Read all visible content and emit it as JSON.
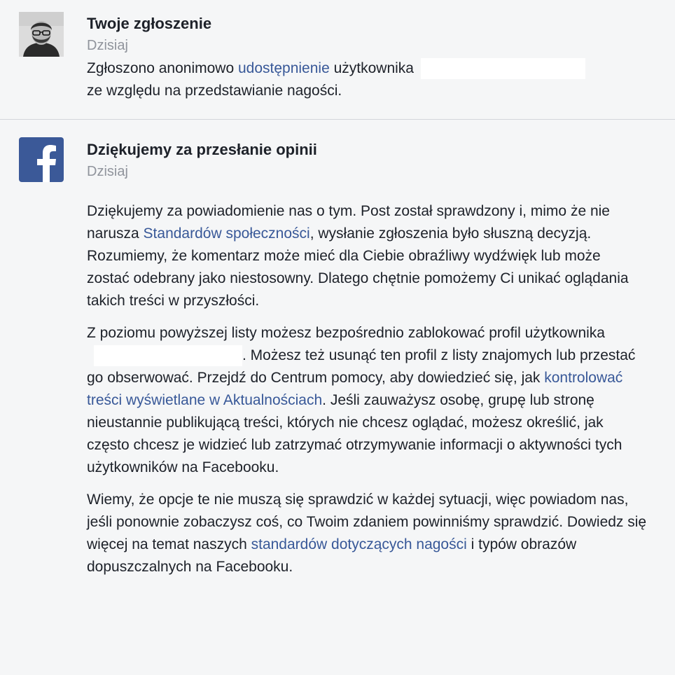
{
  "report": {
    "title": "Twoje zgłoszenie",
    "time": "Dzisiaj",
    "text_before": "Zgłoszono anonimowo ",
    "link": "udostępnienie",
    "text_after": " użytkownika",
    "line2": "ze względu na przedstawianie nagości."
  },
  "feedback": {
    "title": "Dziękujemy za przesłanie opinii",
    "time": "Dzisiaj",
    "p1_a": "Dziękujemy za powiadomienie nas o tym. Post został sprawdzony i, mimo że nie narusza ",
    "p1_link": "Standardów społeczności",
    "p1_b": ", wysłanie zgłoszenia było słuszną decyzją. Rozumiemy, że komentarz może mieć dla Ciebie obraźliwy wydźwięk lub może zostać odebrany jako niestosowny. Dlatego chętnie pomożemy Ci unikać oglądania takich treści w przyszłości.",
    "p2_a": "Z poziomu powyższej listy możesz bezpośrednio zablokować profil użytkownika",
    "p2_b": ". Możesz też usunąć ten profil z listy znajomych lub przestać go obserwować. Przejdź do Centrum pomocy, aby dowiedzieć się, jak ",
    "p2_link": "kontrolować treści wyświetlane w Aktualnościach",
    "p2_c": ". Jeśli zauważysz osobę, grupę lub stronę nieustannie publikującą treści, których nie chcesz oglądać, możesz określić, jak często chcesz je widzieć lub zatrzymać otrzymywanie informacji o aktywności tych użytkowników na Facebooku.",
    "p3_a": "Wiemy, że opcje te nie muszą się sprawdzić w każdej sytuacji, więc powiadom nas, jeśli ponownie zobaczysz coś, co Twoim zdaniem powinniśmy sprawdzić. Dowiedz się więcej na temat naszych ",
    "p3_link": "standardów dotyczących nagości",
    "p3_b": " i typów obrazów dopuszczalnych na Facebooku."
  },
  "icons": {
    "avatar": "user-avatar-icon",
    "facebook": "facebook-logo-icon"
  },
  "colors": {
    "background": "#f5f6f7",
    "link": "#385898",
    "secondary": "#90949c",
    "facebook_blue": "#3b5998"
  }
}
